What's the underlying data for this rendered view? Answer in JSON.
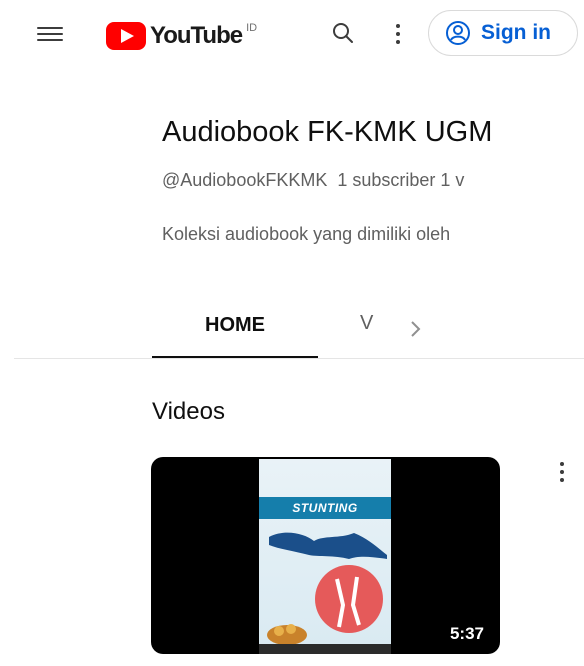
{
  "header": {
    "logo_text": "YouTube",
    "country_code": "ID",
    "signin_label": "Sign in",
    "icons": [
      "menu-icon",
      "search-icon",
      "more-vert-icon",
      "user-circle-icon"
    ]
  },
  "channel": {
    "name": "Audiobook FK-KMK UGM",
    "handle": "@AudiobookFKKMK",
    "subscribers": "1 subscriber",
    "videos_count_partial": "1 v",
    "description": "Koleksi audiobook yang dimiliki oleh"
  },
  "tabs": [
    {
      "label": "HOME",
      "selected": true
    },
    {
      "label": "V",
      "selected": false
    }
  ],
  "section": {
    "title": "Videos"
  },
  "videos": [
    {
      "duration": "5:37",
      "thumbnail_text": "STUNTING"
    }
  ],
  "colors": {
    "brand_red": "#ff0000",
    "link_blue": "#065fd4",
    "text_primary": "#0f0f0f",
    "text_secondary": "#606060"
  }
}
